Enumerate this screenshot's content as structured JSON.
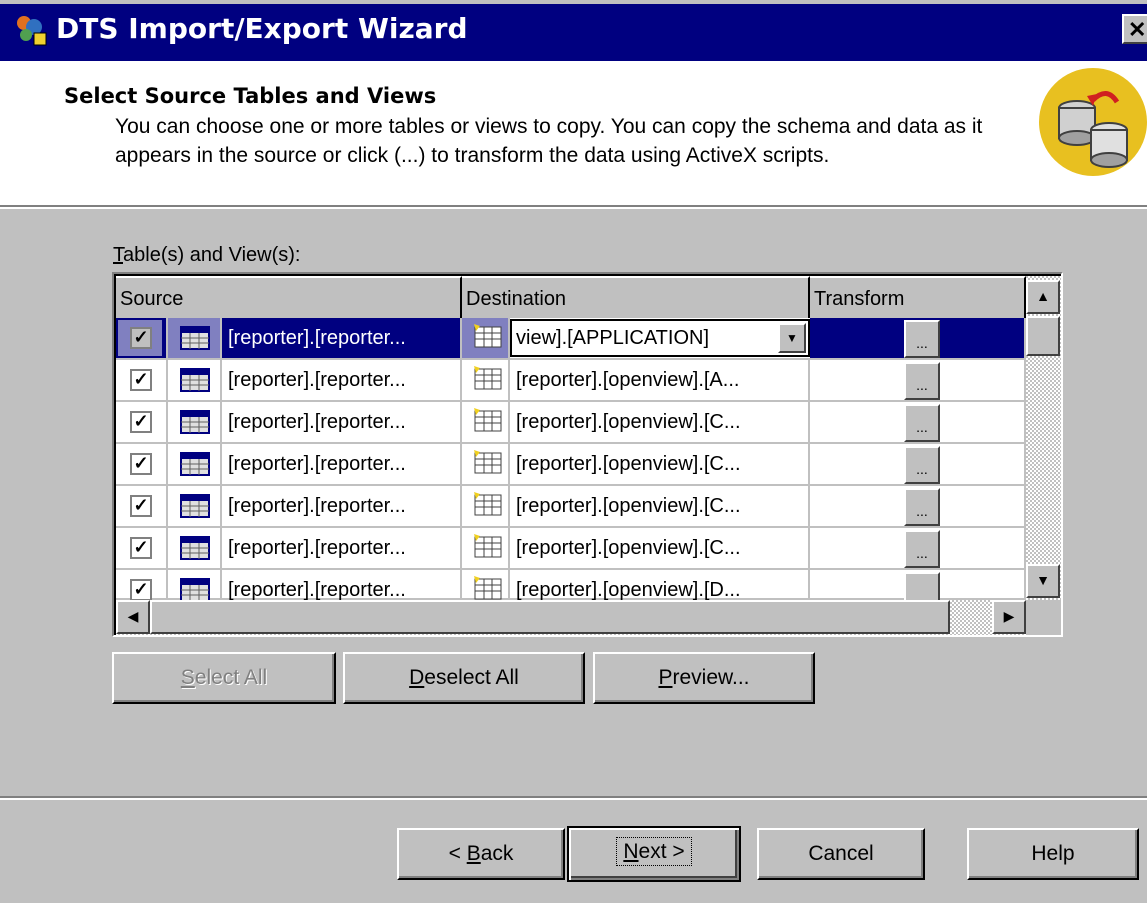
{
  "window": {
    "title": "DTS Import/Export Wizard",
    "close_glyph": "✕",
    "icon": "dts-wizard-icon"
  },
  "header": {
    "title": "Select Source Tables and Views",
    "description": "You can choose one or more tables or views to copy.  You can copy the schema and data as it appears in the source or click (...) to transform the data using ActiveX scripts.",
    "icon": "database-copy-icon"
  },
  "list": {
    "label_accel": "T",
    "label_rest": "able(s) and View(s):",
    "columns": [
      "Source",
      "Destination",
      "Transform"
    ],
    "rows": [
      {
        "checked": true,
        "source": "[reporter].[reporter...",
        "destination": "view].[APPLICATION]",
        "transform": "...",
        "selected": true
      },
      {
        "checked": true,
        "source": "[reporter].[reporter...",
        "destination": "[reporter].[openview].[A...",
        "transform": "..."
      },
      {
        "checked": true,
        "source": "[reporter].[reporter...",
        "destination": "[reporter].[openview].[C...",
        "transform": "..."
      },
      {
        "checked": true,
        "source": "[reporter].[reporter...",
        "destination": "[reporter].[openview].[C...",
        "transform": "..."
      },
      {
        "checked": true,
        "source": "[reporter].[reporter...",
        "destination": "[reporter].[openview].[C...",
        "transform": "..."
      },
      {
        "checked": true,
        "source": "[reporter].[reporter...",
        "destination": "[reporter].[openview].[C...",
        "transform": "..."
      },
      {
        "checked": true,
        "source": "[reporter].[reporter...",
        "destination": "[reporter].[openview].[D...",
        "transform": ""
      }
    ]
  },
  "actions": {
    "select_all": {
      "accel": "S",
      "rest": "elect All",
      "enabled": false
    },
    "deselect_all": {
      "accel": "D",
      "rest": "eselect All"
    },
    "preview": {
      "accel": "P",
      "rest": "review..."
    }
  },
  "footer": {
    "back": {
      "prefix": "< ",
      "accel": "B",
      "rest": "ack"
    },
    "next": {
      "accel": "N",
      "rest": "ext >"
    },
    "cancel": "Cancel",
    "help": "Help"
  },
  "colors": {
    "titlebar": "#000080",
    "selection": "#000080",
    "face": "#c0c0c0"
  }
}
